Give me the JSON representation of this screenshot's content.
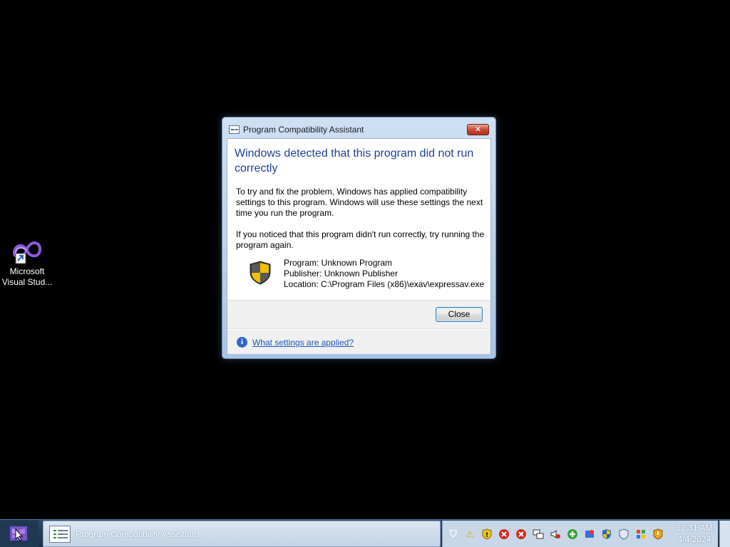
{
  "desktop": {
    "icons": [
      {
        "label_line1": "Microsoft",
        "label_line2": "Visual Stud...",
        "icon": "visual-studio-icon"
      }
    ]
  },
  "dialog": {
    "title": "Program Compatibility Assistant",
    "close_glyph": "✕",
    "heading": "Windows detected that this program did not run correctly",
    "paragraph1": "To try and fix the problem, Windows has applied compatibility settings to this program.  Windows will use these settings the next time you run the program.",
    "paragraph2": "If you noticed that this program didn't run correctly, try running the program again.",
    "program_line": "Program: Unknown Program",
    "publisher_line": "Publisher: Unknown Publisher",
    "location_line": "Location: C:\\Program Files (x86)\\exav\\expressav.exe",
    "close_button_label": "Close",
    "info_glyph": "i",
    "footer_link": "What settings are applied?"
  },
  "taskbar": {
    "task_button_label": "Program Compatibility Assistant",
    "tray_icons": [
      "shield-outline-icon",
      "warning-icon",
      "shield-alert-icon",
      "error-icon",
      "error-icon",
      "network-icon",
      "volume-muted-icon",
      "add-green-icon",
      "app-tray-icon",
      "uac-shield-icon",
      "security-shield-icon",
      "windows-flag-icon",
      "shield-warning-icon"
    ],
    "clock_time": "12:31 AM",
    "clock_date": "4/4/2024"
  },
  "colors": {
    "heading_blue": "#1e3f9a",
    "link_blue": "#1c58b8",
    "close_red": "#c94b36",
    "desktop_bg": "#000000"
  }
}
